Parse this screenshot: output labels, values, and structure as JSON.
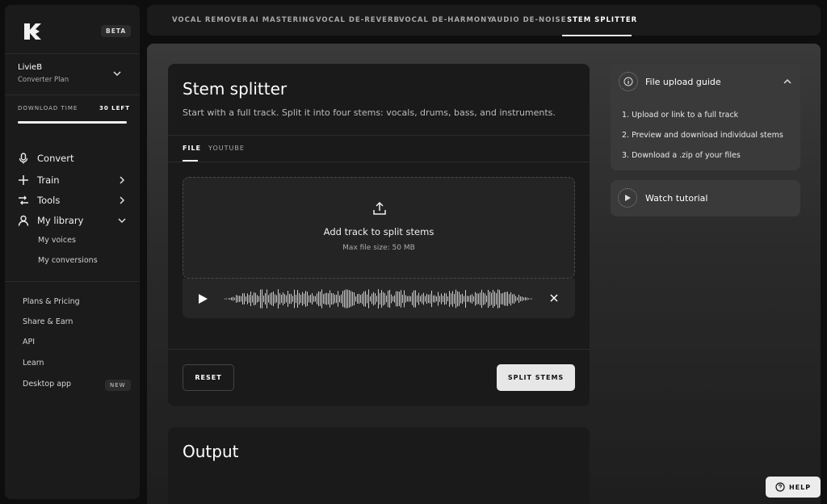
{
  "sidebar": {
    "beta_badge": "BETA",
    "user": {
      "name": "LivieB",
      "plan": "Converter Plan"
    },
    "download": {
      "label": "DOWNLOAD TIME",
      "left": "30 LEFT",
      "remaining_fraction": 1.0
    },
    "nav": [
      {
        "label": "Convert",
        "icon": "microphone-icon"
      },
      {
        "label": "Train",
        "icon": "plus-icon"
      },
      {
        "label": "Tools",
        "icon": "tools-icon"
      },
      {
        "label": "My library",
        "icon": "user-icon"
      }
    ],
    "library_sub": [
      "My voices",
      "My conversions"
    ],
    "links": [
      "Plans & Pricing",
      "Share & Earn",
      "API",
      "Learn",
      "Desktop app"
    ],
    "new_badge": "NEW"
  },
  "top_tabs": [
    "VOCAL REMOVER",
    "AI MASTERING",
    "VOCAL DE-REVERB",
    "VOCAL DE-HARMONY",
    "AUDIO DE-NOISE",
    "STEM SPLITTER"
  ],
  "active_tab": "STEM SPLITTER",
  "card": {
    "title": "Stem splitter",
    "description": "Start with a full track. Split it into four stems: vocals, drums, bass, and instruments.",
    "tabs": [
      "FILE",
      "YOUTUBE"
    ],
    "dropzone": {
      "title": "Add track to split stems",
      "subtitle": "Max file size: 50 MB"
    },
    "reset_label": "RESET",
    "split_label": "SPLIT STEMS"
  },
  "output": {
    "title": "Output"
  },
  "guide": {
    "title": "File upload guide",
    "steps": [
      "1. Upload or link to a full track",
      "2. Preview and download individual stems",
      "3. Download a .zip of your files"
    ]
  },
  "tutorial": {
    "title": "Watch tutorial"
  },
  "help_label": "HELP",
  "colors": {
    "background": "#0e0e0e",
    "panel": "#1b1b1b",
    "card": "#1a1a1a",
    "button_light": "#e7e7e7"
  }
}
